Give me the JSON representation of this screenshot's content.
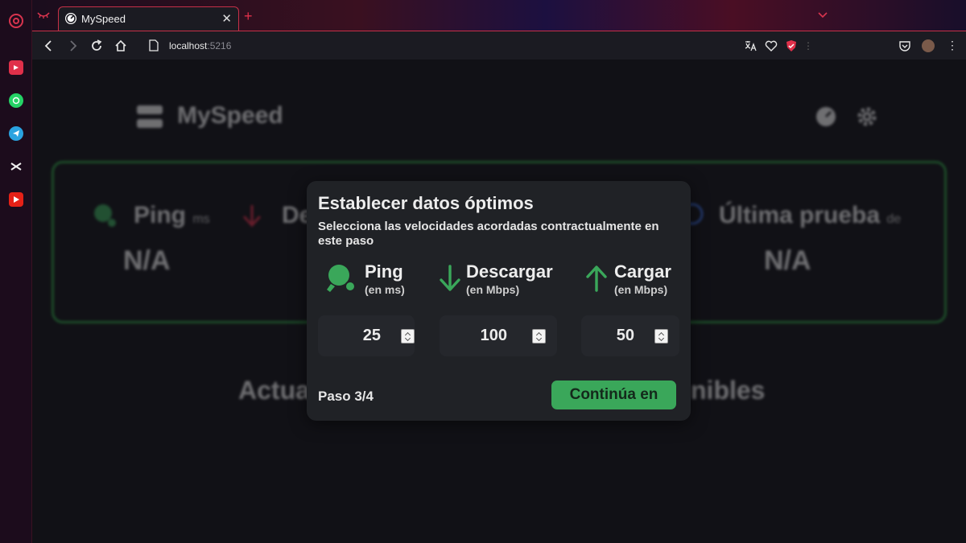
{
  "browser": {
    "tab": {
      "title": "MySpeed"
    },
    "address": {
      "host": "localhost",
      "port": ":5216"
    }
  },
  "background": {
    "app_name": "MySpeed",
    "stats": [
      {
        "label": "Ping",
        "unit": "ms",
        "value": "N/A"
      },
      {
        "label": "De",
        "unit": "",
        "value": ""
      },
      {
        "label": "Última prueba",
        "unit": "de",
        "value": "N/A"
      }
    ],
    "heading_left": "Actua",
    "heading_right": "nibles"
  },
  "modal": {
    "title": "Establecer datos óptimos",
    "subtitle": "Selecciona las velocidades acordadas contractualmente en este paso",
    "metrics": [
      {
        "label": "Ping",
        "unit": "(en ms)",
        "value": "25"
      },
      {
        "label": "Descargar",
        "unit": "(en Mbps)",
        "value": "100"
      },
      {
        "label": "Cargar",
        "unit": "(en Mbps)",
        "value": "50"
      }
    ],
    "step": "Paso 3/4",
    "continue_label": "Continúa en"
  },
  "colors": {
    "accent_green": "#3aa75a",
    "browser_red": "#c73048",
    "modal_bg": "#202226"
  }
}
